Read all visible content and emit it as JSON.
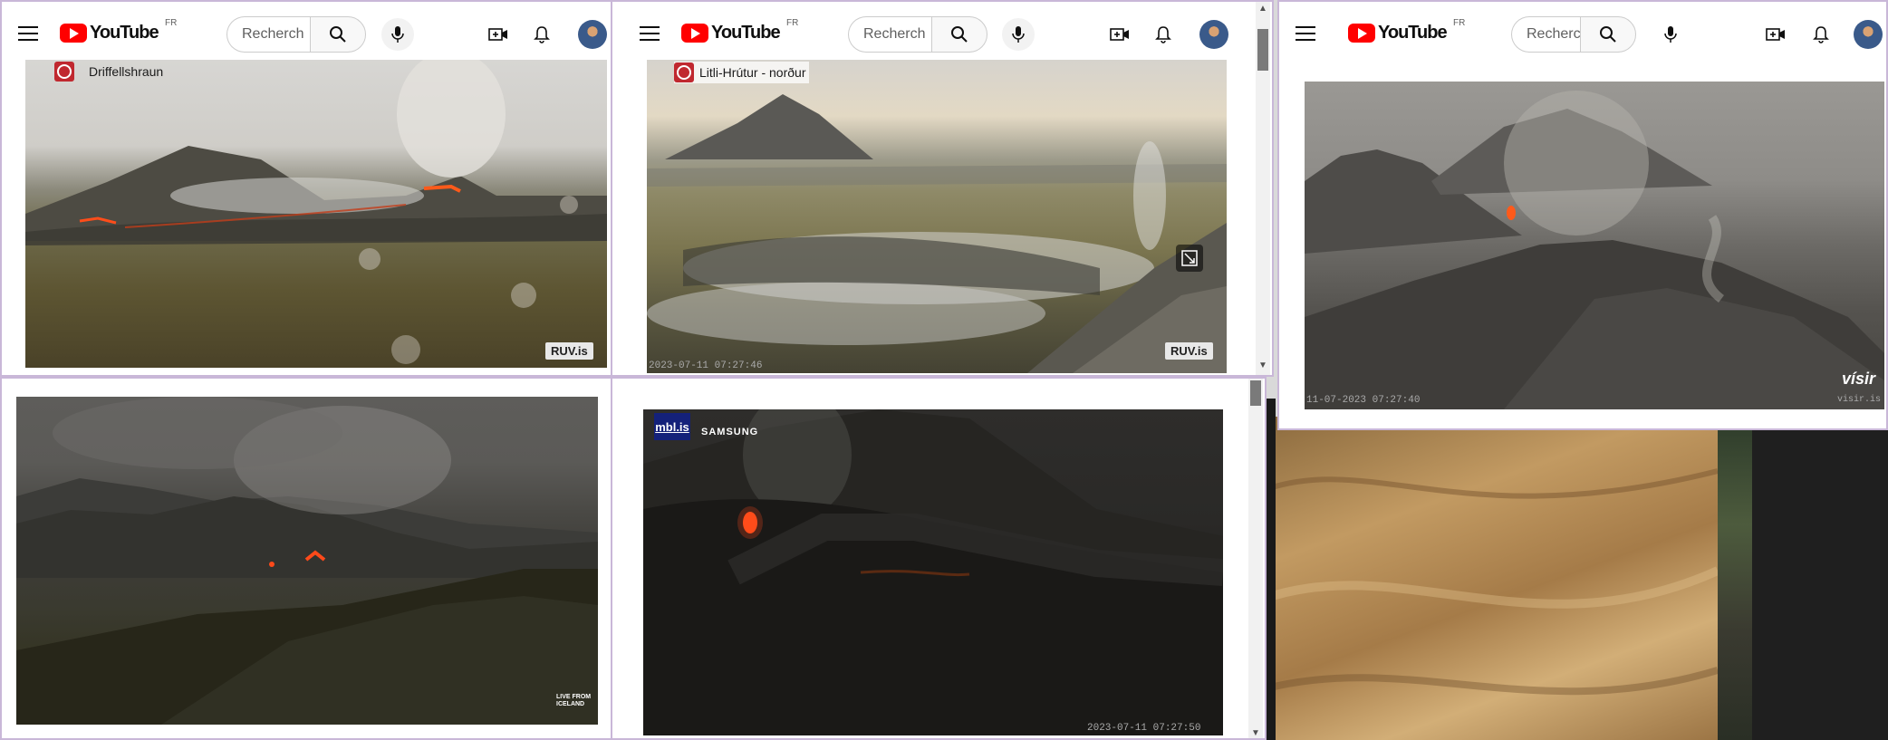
{
  "youtube": {
    "brand": "YouTube",
    "region": "FR",
    "search_placeholders": [
      "Recherch",
      "Recherch",
      "Recherc"
    ]
  },
  "streams": {
    "s1": {
      "label": "Driffellshraun",
      "badge": "RUV.is"
    },
    "s2": {
      "label": "Litli-Hrútur - norður",
      "badge": "RUV.is",
      "timestamp": "2023-07-11  07:27:46"
    },
    "s3": {
      "watermark": "vísir",
      "watermark_small": "visir.is",
      "timestamp": "11-07-2023  07:27:40"
    },
    "s4": {
      "watermark": "LIVE FROM ICELAND"
    },
    "s5": {
      "brand": "mbl.is",
      "sponsor": "SAMSUNG",
      "timestamp": "2023-07-11  07:27:50"
    }
  }
}
